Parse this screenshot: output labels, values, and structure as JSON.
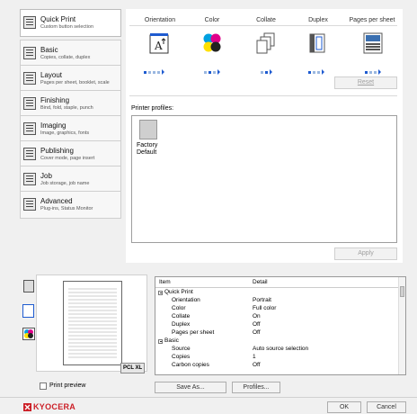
{
  "nav": {
    "items": [
      {
        "title": "Quick Print",
        "subtitle": "Custom button selection"
      },
      {
        "title": "Basic",
        "subtitle": "Copies, collate, duplex"
      },
      {
        "title": "Layout",
        "subtitle": "Pages per sheet, booklet, scale"
      },
      {
        "title": "Finishing",
        "subtitle": "Bind, fold, staple, punch"
      },
      {
        "title": "Imaging",
        "subtitle": "Image, graphics, fonts"
      },
      {
        "title": "Publishing",
        "subtitle": "Cover mode, page insert"
      },
      {
        "title": "Job",
        "subtitle": "Job storage, job name"
      },
      {
        "title": "Advanced",
        "subtitle": "Plug-ins, Status Monitor"
      }
    ]
  },
  "quick_print": {
    "columns": [
      "Orientation",
      "Color",
      "Collate",
      "Duplex",
      "Pages per sheet"
    ],
    "reset_label": "Reset",
    "profiles_label": "Printer profiles:",
    "profile_name": "Factory Default",
    "apply_label": "Apply"
  },
  "preview": {
    "pdl_badge": "PCL XL",
    "print_preview_label": "Print preview"
  },
  "details": {
    "headers": {
      "item": "Item",
      "detail": "Detail"
    },
    "rows": [
      {
        "item": "Quick Print",
        "detail": "",
        "group": true
      },
      {
        "item": "Orientation",
        "detail": "Portrait"
      },
      {
        "item": "Color",
        "detail": "Full color"
      },
      {
        "item": "Collate",
        "detail": "On"
      },
      {
        "item": "Duplex",
        "detail": "Off"
      },
      {
        "item": "Pages per sheet",
        "detail": "Off"
      },
      {
        "item": "Basic",
        "detail": "",
        "group": true
      },
      {
        "item": "Source",
        "detail": "Auto source selection"
      },
      {
        "item": "Copies",
        "detail": "1"
      },
      {
        "item": "Carbon copies",
        "detail": "Off"
      }
    ]
  },
  "buttons": {
    "save_as": "Save As...",
    "profiles": "Profiles...",
    "ok": "OK",
    "cancel": "Cancel"
  },
  "brand": {
    "name": "KYOCERA",
    "color": "#cc1f27"
  },
  "colors": {
    "selected_nav": "#ffffff",
    "accent_blue": "#1e5bd0"
  }
}
